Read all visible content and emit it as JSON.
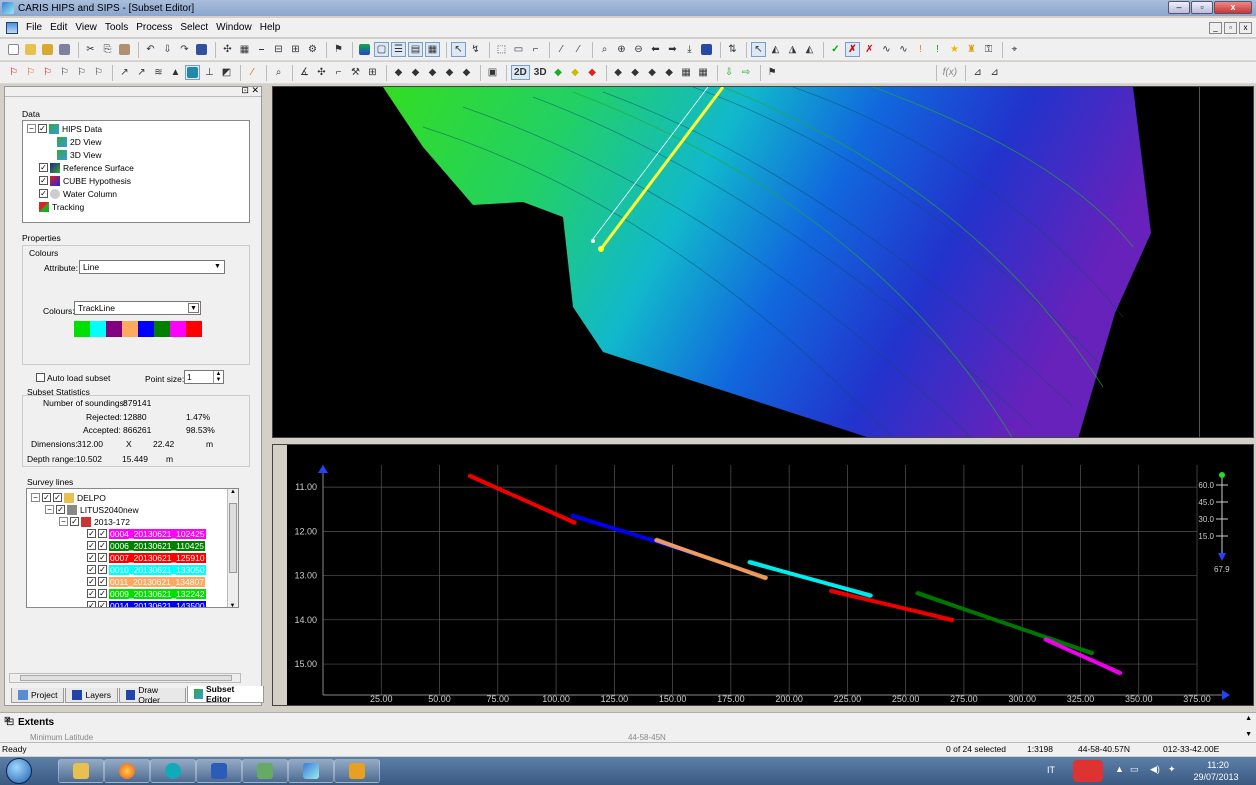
{
  "window": {
    "title": "CARIS HIPS and SIPS - [Subset Editor]"
  },
  "menu": [
    "File",
    "Edit",
    "View",
    "Tools",
    "Process",
    "Select",
    "Window",
    "Help"
  ],
  "toolbar": {
    "btn_2d": "2D",
    "btn_3d": "3D",
    "fx": "f(x)"
  },
  "data_panel": {
    "label": "Data",
    "tree": [
      "HIPS Data",
      "2D View",
      "3D View",
      "Reference Surface",
      "CUBE Hypothesis",
      "Water Column",
      "Tracking"
    ]
  },
  "properties": {
    "label": "Properties",
    "colours_group": "Colours",
    "attribute_label": "Attribute:",
    "attribute_value": "Line",
    "colours_label": "Colours:",
    "colours_value": "TrackLine",
    "palette": [
      "#00e000",
      "#00ffff",
      "#800080",
      "#ffa860",
      "#0000ff",
      "#008000",
      "#ff00ff",
      "#ff0000"
    ],
    "auto_load": "Auto load subset",
    "point_size_label": "Point size:",
    "point_size": "1"
  },
  "stats": {
    "label": "Subset Statistics",
    "num_soundings_label": "Number of soundings:",
    "num_soundings": "879141",
    "rejected_label": "Rejected:",
    "rejected": "12880",
    "rejected_pct": "1.47%",
    "accepted_label": "Accepted:",
    "accepted": "866261",
    "accepted_pct": "98.53%",
    "dimensions_label": "Dimensions:",
    "dim_x": "312.00",
    "dim_times": "X",
    "dim_y": "22.42",
    "dim_unit": "m",
    "depth_label": "Depth range:",
    "depth_min": "10.502",
    "depth_max": "15.449",
    "depth_unit": "m"
  },
  "survey": {
    "label": "Survey lines",
    "root": "DELPO",
    "vessel": "LITUS2040new",
    "day": "2013-172",
    "lines": [
      {
        "name": "0004_20130621_102425",
        "color": "#ff00ff"
      },
      {
        "name": "0006_20130621_110425",
        "color": "#008000"
      },
      {
        "name": "0007_20130621_125910",
        "color": "#ff0000"
      },
      {
        "name": "0010_20130621_133050",
        "color": "#00ffff"
      },
      {
        "name": "0011_20130621_134807",
        "color": "#ffa860"
      },
      {
        "name": "0009_20130621_132242",
        "color": "#00e000"
      },
      {
        "name": "0014_20130621_143500",
        "color": "#0000ff"
      }
    ]
  },
  "tabs": [
    "Project",
    "Layers",
    "Draw Order",
    "Subset Editor"
  ],
  "chart_data": {
    "type": "scatter",
    "xlim": [
      0,
      375
    ],
    "ylim": [
      10.5,
      15.7
    ],
    "y_inverted": true,
    "xticks": [
      "25.00",
      "50.00",
      "75.00",
      "100.00",
      "125.00",
      "150.00",
      "175.00",
      "200.00",
      "225.00",
      "250.00",
      "275.00",
      "300.00",
      "325.00",
      "350.00",
      "375.00"
    ],
    "yticks": [
      "11.00",
      "12.00",
      "13.00",
      "14.00",
      "15.00"
    ],
    "angle_scale": [
      "60.0",
      "45.0",
      "30.0",
      "15.0",
      "67.9"
    ],
    "grid": true,
    "series": [
      {
        "color": "#ff0000",
        "x": [
          63,
          108
        ],
        "y": [
          10.75,
          11.8
        ]
      },
      {
        "color": "#0000ff",
        "x": [
          107,
          160
        ],
        "y": [
          11.65,
          12.5
        ]
      },
      {
        "color": "#ffa860",
        "x": [
          143,
          190
        ],
        "y": [
          12.2,
          13.05
        ]
      },
      {
        "color": "#00ffff",
        "x": [
          183,
          235
        ],
        "y": [
          12.7,
          13.45
        ]
      },
      {
        "color": "#ff0000",
        "x": [
          218,
          270
        ],
        "y": [
          13.35,
          14.0
        ]
      },
      {
        "color": "#008000",
        "x": [
          255,
          330
        ],
        "y": [
          13.4,
          14.75
        ]
      },
      {
        "color": "#ff00ff",
        "x": [
          310,
          342
        ],
        "y": [
          14.45,
          15.2
        ]
      }
    ]
  },
  "extents": {
    "title": "Extents",
    "sub_label": "Minimum Latitude",
    "sub_value": "44-58-45N"
  },
  "status": {
    "text": "Ready",
    "selected": "0 of 24 selected",
    "scale": "1:3198",
    "lat": "44-58-40.57N",
    "lon": "012-33-42.00E"
  },
  "taskbar": {
    "lang": "IT",
    "time": "11:20",
    "date": "29/07/2013"
  }
}
